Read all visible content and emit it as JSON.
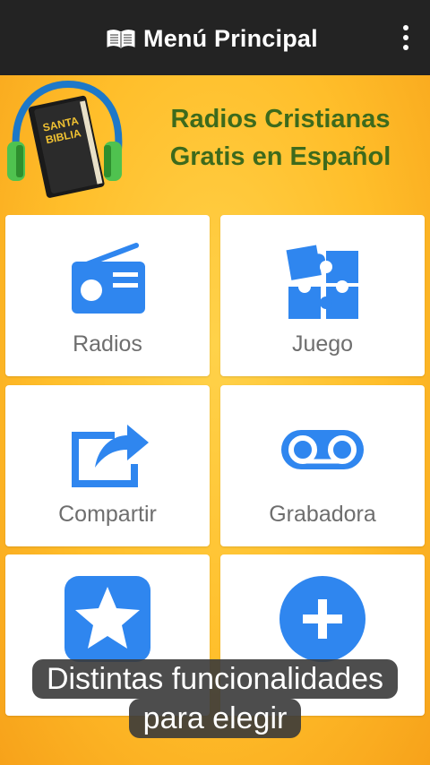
{
  "appbar": {
    "title": "Menú Principal",
    "icons": {
      "book": "open-book-icon",
      "menu": "overflow-menu-icon"
    }
  },
  "banner": {
    "logo_text": [
      "SANTA",
      "BIBLIA"
    ],
    "headline_line1": "Radios Cristianas",
    "headline_line2": "Gratis en Español",
    "headline_color": "#3d6a1c"
  },
  "menu": {
    "accent_color": "#2f86ef",
    "items": [
      {
        "label": "Radios",
        "icon": "radio-icon"
      },
      {
        "label": "Juego",
        "icon": "puzzle-icon"
      },
      {
        "label": "Compartir",
        "icon": "share-icon"
      },
      {
        "label": "Grabadora",
        "icon": "voicemail-icon"
      },
      {
        "label": "",
        "icon": "star-icon"
      },
      {
        "label": "",
        "icon": "plus-icon"
      }
    ]
  },
  "caption": {
    "line1": "Distintas funcionalidades",
    "line2": "para elegir"
  }
}
